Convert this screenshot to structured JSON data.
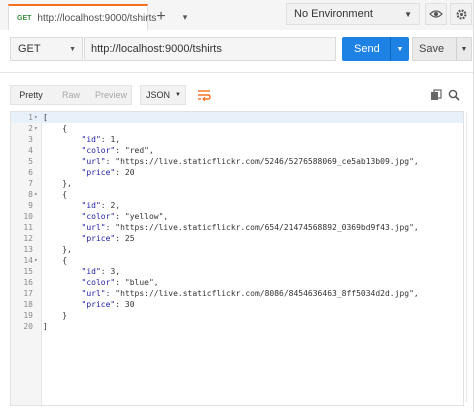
{
  "tab": {
    "method": "GET",
    "url": "http://localhost:9000/tshirts",
    "new_tab": "+",
    "more": "▾"
  },
  "environment": {
    "selected": "No Environment"
  },
  "request": {
    "method": "GET",
    "url": "http://localhost:9000/tshirts",
    "send_label": "Send",
    "save_label": "Save"
  },
  "response_toolbar": {
    "pretty": "Pretty",
    "raw": "Raw",
    "preview": "Preview",
    "format": "JSON"
  },
  "colors": {
    "accent": "#f47023",
    "send": "#1e81e4",
    "json_value": "#1a1aa6"
  },
  "code_lines": [
    {
      "n": "1",
      "fold": "▾",
      "text": "["
    },
    {
      "n": "2",
      "fold": "▾",
      "text": "    {"
    },
    {
      "n": "3",
      "fold": "",
      "text": "        \"id\": 1,"
    },
    {
      "n": "4",
      "fold": "",
      "text": "        \"color\": \"red\","
    },
    {
      "n": "5",
      "fold": "",
      "text": "        \"url\": \"https://live.staticflickr.com/5246/5276588069_ce5ab13b09.jpg\","
    },
    {
      "n": "6",
      "fold": "",
      "text": "        \"price\": 20"
    },
    {
      "n": "7",
      "fold": "",
      "text": "    },"
    },
    {
      "n": "8",
      "fold": "▾",
      "text": "    {"
    },
    {
      "n": "9",
      "fold": "",
      "text": "        \"id\": 2,"
    },
    {
      "n": "10",
      "fold": "",
      "text": "        \"color\": \"yellow\","
    },
    {
      "n": "11",
      "fold": "",
      "text": "        \"url\": \"https://live.staticflickr.com/654/21474568892_0369bd9f43.jpg\","
    },
    {
      "n": "12",
      "fold": "",
      "text": "        \"price\": 25"
    },
    {
      "n": "13",
      "fold": "",
      "text": "    },"
    },
    {
      "n": "14",
      "fold": "▾",
      "text": "    {"
    },
    {
      "n": "15",
      "fold": "",
      "text": "        \"id\": 3,"
    },
    {
      "n": "16",
      "fold": "",
      "text": "        \"color\": \"blue\","
    },
    {
      "n": "17",
      "fold": "",
      "text": "        \"url\": \"https://live.staticflickr.com/8086/8454636463_8ff5034d2d.jpg\","
    },
    {
      "n": "18",
      "fold": "",
      "text": "        \"price\": 30"
    },
    {
      "n": "19",
      "fold": "",
      "text": "    }"
    },
    {
      "n": "20",
      "fold": "",
      "text": "]"
    }
  ]
}
